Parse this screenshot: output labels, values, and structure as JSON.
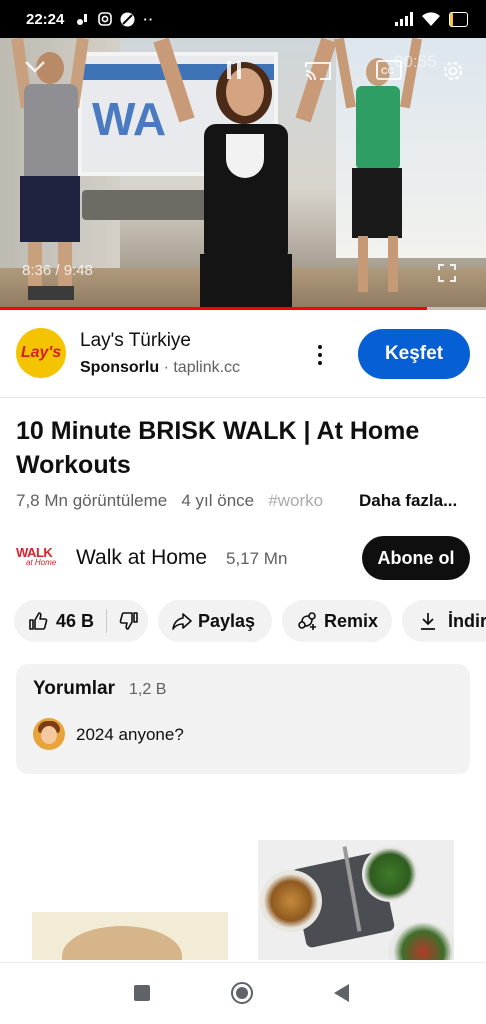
{
  "status_bar": {
    "time": "22:24",
    "battery": "20",
    "battery_level_percent": 20
  },
  "player": {
    "time_display": "8:36 / 9:48",
    "corner_countdown": "00:55",
    "progress_fraction": 0.879,
    "icons": [
      "collapse-icon",
      "pause-icon",
      "cast-icon",
      "captions-icon",
      "settings-icon",
      "fullscreen-icon"
    ]
  },
  "ad": {
    "advertiser": "Lay's Türkiye",
    "logo_text": "Lay's",
    "sponsored_label": "Sponsorlu",
    "separator": "·",
    "domain": "taplink.cc",
    "cta_label": "Keşfet",
    "cta_color": "#065fd4"
  },
  "video": {
    "title": "10 Minute BRISK WALK | At Home Workouts",
    "views": "7,8 Mn görüntüleme",
    "age": "4 yıl önce",
    "hashtag": "#worko",
    "more_label": "Daha fazla..."
  },
  "channel": {
    "logo_text": "WALK",
    "logo_subtext": "at Home",
    "name": "Walk at Home",
    "subscribers": "5,17 Mn",
    "subscribe_label": "Abone ol"
  },
  "actions": {
    "likes": "46 B",
    "share_label": "Paylaş",
    "remix_label": "Remix",
    "download_label": "İndir"
  },
  "comments": {
    "header": "Yorumlar",
    "count": "1,2 B",
    "top_comment": "2024 anyone?"
  },
  "colors": {
    "progress_played": "#ff0000",
    "subscribe_bg": "#0f0f0f",
    "pill_bg": "#f2f2f2"
  }
}
